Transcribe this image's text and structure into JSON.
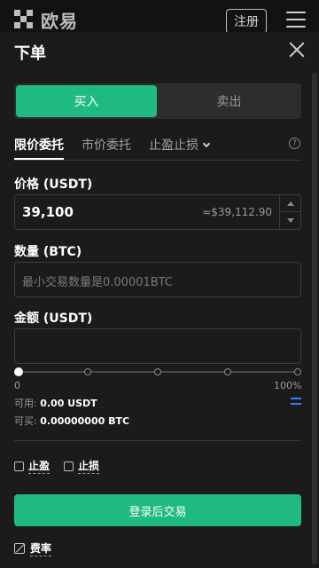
{
  "header": {
    "logo_text": "欧易",
    "register_label": "注册"
  },
  "panel": {
    "title": "下单"
  },
  "side": {
    "buy_label": "买入",
    "sell_label": "卖出",
    "selected": "buy"
  },
  "order_tabs": [
    {
      "label": "限价委托",
      "active": true
    },
    {
      "label": "市价委托",
      "active": false
    },
    {
      "label": "止盈止损",
      "active": false
    }
  ],
  "price": {
    "label": "价格 (USDT)",
    "value": "39,100",
    "approx": "≈$39,112.90"
  },
  "amount": {
    "label": "数量 (BTC)",
    "placeholder": "最小交易数量是0.00001BTC"
  },
  "total": {
    "label": "金额 (USDT)",
    "value": ""
  },
  "slider": {
    "level_percent": 0,
    "min_label": "0",
    "max_label": "100%"
  },
  "balance": {
    "available_prefix": "可用: ",
    "available_value": "0.00 USDT",
    "buyable_prefix": "可买: ",
    "buyable_value": "0.00000000 BTC"
  },
  "options": {
    "take_profit_label": "止盈",
    "stop_loss_label": "止损"
  },
  "submit_label": "登录后交易",
  "fee_label": "费率",
  "colors": {
    "buy_green": "#1fba7f",
    "background": "#1b1b1b",
    "swap_blue": "#3a7ff0"
  },
  "icons": [
    "okx-logo",
    "menu-icon",
    "close-icon",
    "help-icon",
    "swap-icon",
    "fee-icon",
    "chevron-down-icon"
  ]
}
